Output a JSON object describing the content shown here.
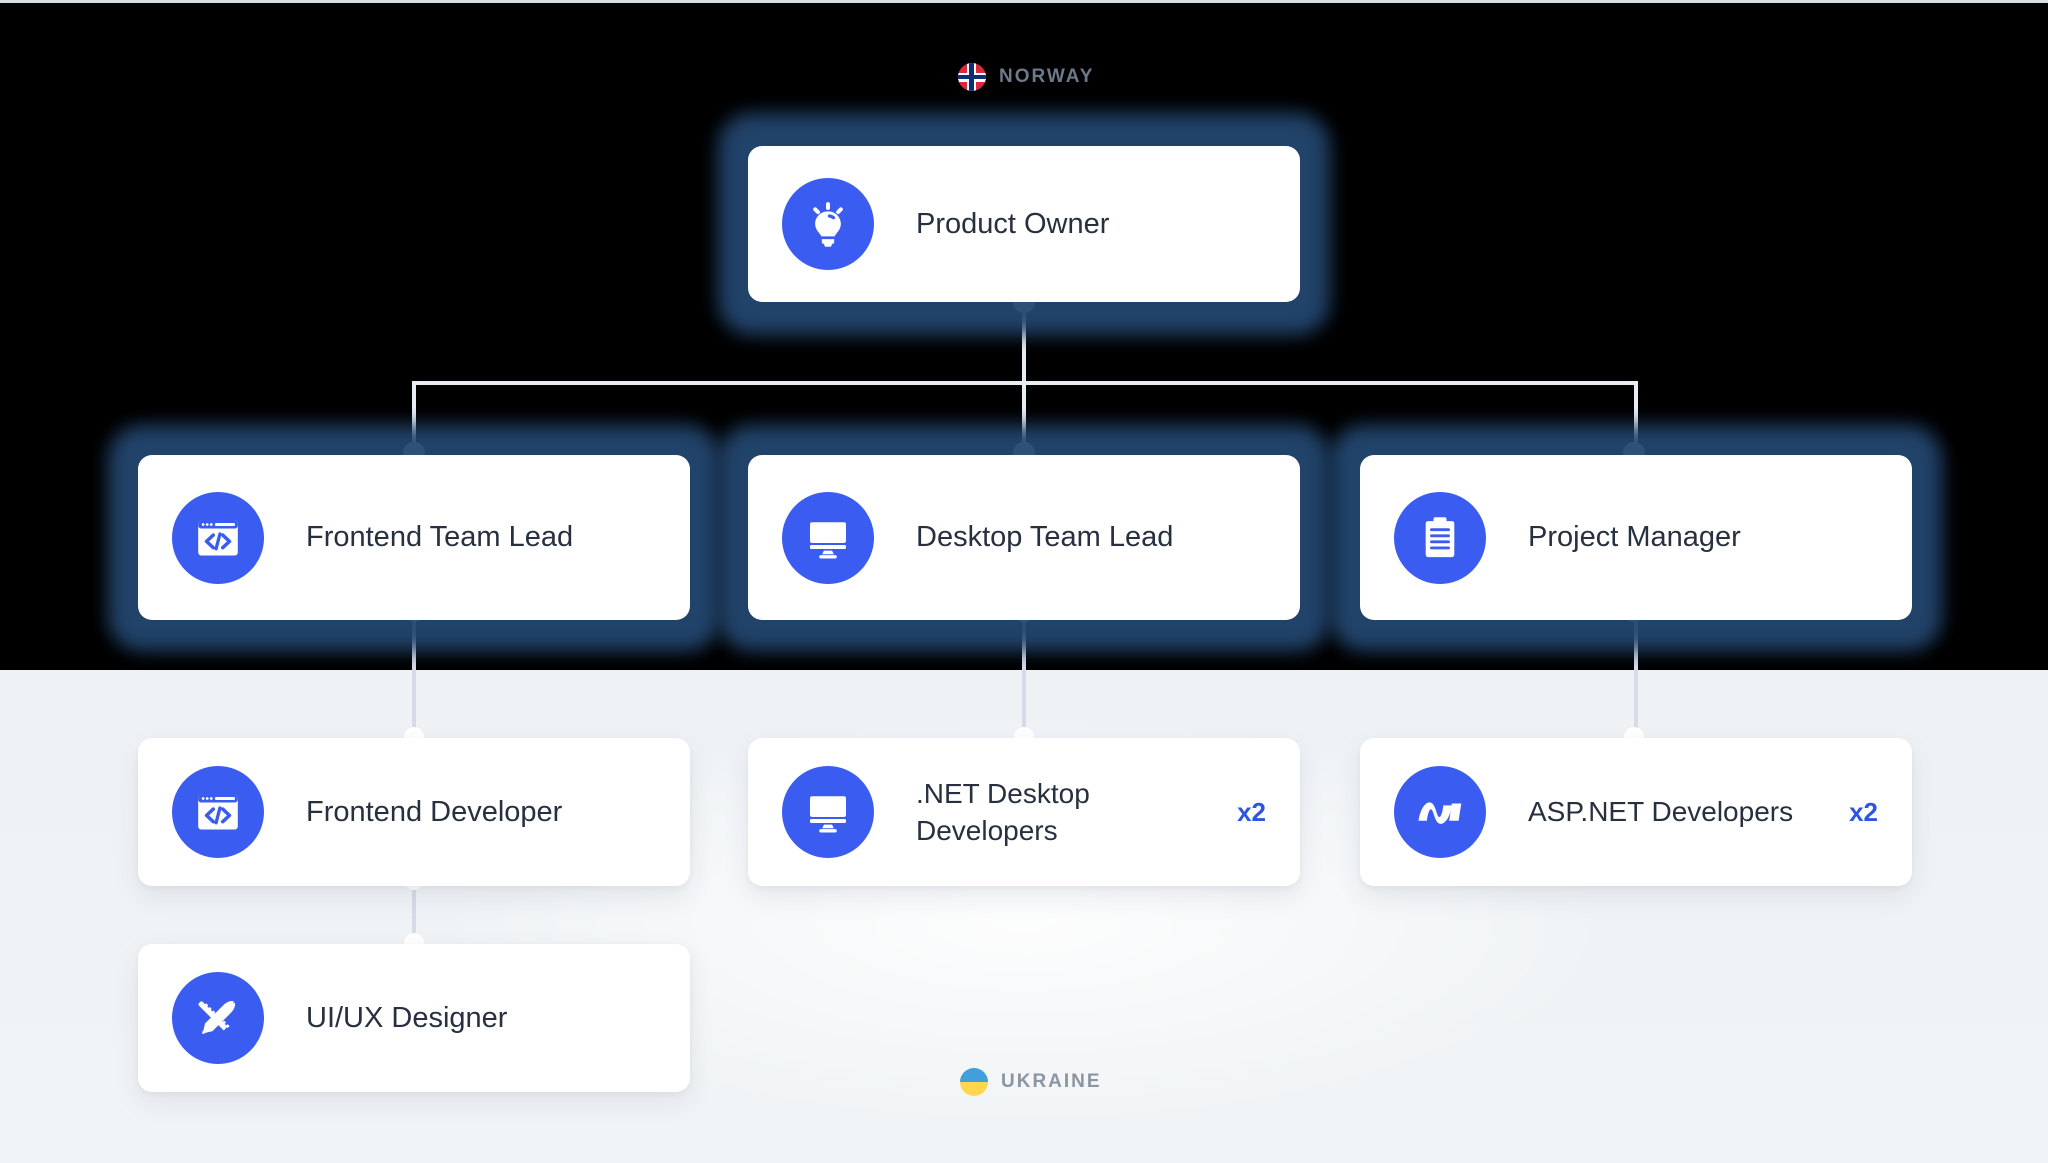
{
  "regions": {
    "top": {
      "label": "NORWAY",
      "flag": "norway-flag-icon"
    },
    "bottom": {
      "label": "UKRAINE",
      "flag": "ukraine-flag-icon"
    }
  },
  "theme": {
    "icon_blue": "#3b5cf0",
    "badge_blue": "#2f55e0",
    "glow_navy": "#23466f",
    "dark_bg": "#000000",
    "light_bg": "#eef2f5",
    "connector": "#d6dbe6",
    "title_color": "#27303f"
  },
  "chart_data": {
    "type": "org-chart",
    "title": "",
    "levels": 4,
    "nodes": [
      {
        "id": "product-owner",
        "label": "Product Owner",
        "icon": "lightbulb-icon",
        "count": "",
        "region": "top",
        "level": 1
      },
      {
        "id": "frontend-team-lead",
        "label": "Frontend Team Lead",
        "icon": "code-window-icon",
        "count": "",
        "region": "top",
        "level": 2
      },
      {
        "id": "desktop-team-lead",
        "label": "Desktop Team Lead",
        "icon": "monitor-icon",
        "count": "",
        "region": "top",
        "level": 2
      },
      {
        "id": "project-manager",
        "label": "Project Manager",
        "icon": "clipboard-icon",
        "count": "",
        "region": "top",
        "level": 2
      },
      {
        "id": "frontend-developer",
        "label": "Frontend Developer",
        "icon": "code-window-icon",
        "count": "",
        "region": "bottom",
        "level": 3
      },
      {
        "id": "dotnet-desktop-devs",
        "label": ".NET Desktop Developers",
        "icon": "monitor-icon",
        "count": "x2",
        "region": "bottom",
        "level": 3
      },
      {
        "id": "aspnet-developers",
        "label": "ASP.NET Developers",
        "icon": "aspnet-icon",
        "count": "x2",
        "region": "bottom",
        "level": 3
      },
      {
        "id": "uiux-designer",
        "label": "UI/UX Designer",
        "icon": "design-tools-icon",
        "count": "",
        "region": "bottom",
        "level": 4
      }
    ],
    "edges": [
      {
        "from": "product-owner",
        "to": "frontend-team-lead"
      },
      {
        "from": "product-owner",
        "to": "desktop-team-lead"
      },
      {
        "from": "product-owner",
        "to": "project-manager"
      },
      {
        "from": "frontend-team-lead",
        "to": "frontend-developer"
      },
      {
        "from": "desktop-team-lead",
        "to": "dotnet-desktop-devs"
      },
      {
        "from": "project-manager",
        "to": "aspnet-developers"
      },
      {
        "from": "frontend-developer",
        "to": "uiux-designer"
      }
    ]
  }
}
